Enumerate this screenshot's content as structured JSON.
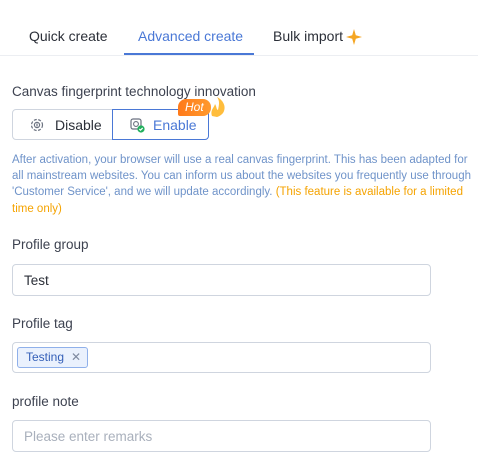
{
  "tabs": [
    {
      "label": "Quick create",
      "active": false
    },
    {
      "label": "Advanced create",
      "active": true
    },
    {
      "label": "Bulk import",
      "active": false,
      "icon": "sparkle-icon"
    }
  ],
  "colors": {
    "accent": "#4a78d6",
    "warning": "#f5a300",
    "hot": "#ff7a1a"
  },
  "fingerprint": {
    "label": "Canvas fingerprint technology innovation",
    "options": [
      {
        "label": "Disable",
        "icon": "fingerprint-icon",
        "selected": false
      },
      {
        "label": "Enable",
        "icon": "fingerprint-check-icon",
        "selected": true
      }
    ],
    "badge": "Hot",
    "description": "After activation, your browser will use a real canvas fingerprint. This has been adapted for all mainstream websites. You can inform us about the websites you frequently use through 'Customer Service', and we will update accordingly.",
    "notice": "(This feature is available for a limited time only)"
  },
  "profile_group": {
    "label": "Profile group",
    "value": "Test"
  },
  "profile_tag": {
    "label": "Profile tag",
    "tags": [
      "Testing"
    ],
    "remove_icon": "close-icon"
  },
  "profile_note": {
    "label": "profile note",
    "value": "",
    "placeholder": "Please enter remarks"
  }
}
